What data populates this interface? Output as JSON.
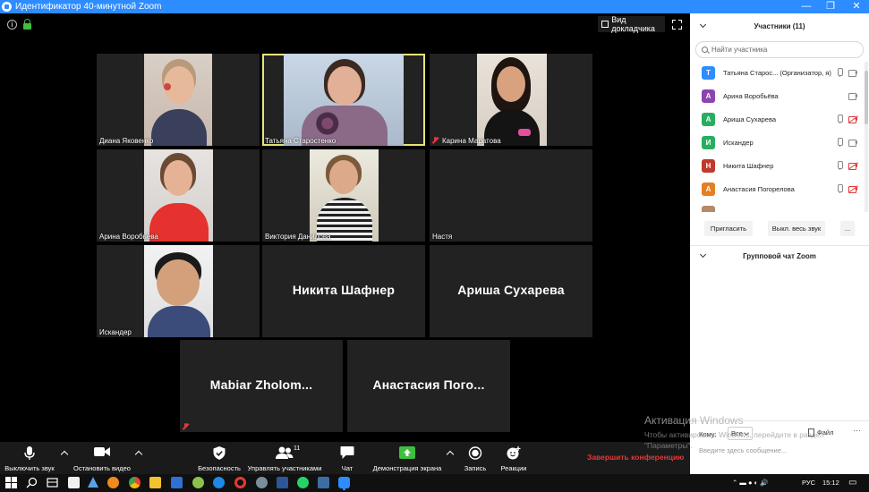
{
  "window": {
    "title": "Идентификатор 40-минутной Zoom"
  },
  "video_header": {
    "speaker_view_label": "Вид докладчика"
  },
  "tiles": [
    {
      "name": "Диана Яковенко",
      "video": true
    },
    {
      "name": "Татьяна Старостенко",
      "video": true,
      "active": true
    },
    {
      "name": "Карина Маратова",
      "video": true,
      "muted": true
    },
    {
      "name": "Арина Воробьёва",
      "video": true
    },
    {
      "name": "Виктория Данилова",
      "video": true
    },
    {
      "name": "Настя",
      "video": false
    },
    {
      "name": "Искандер",
      "video": true
    },
    {
      "display": "Никита Шафнер",
      "video": false
    },
    {
      "display": "Ариша Сухарева",
      "video": false
    },
    {
      "display": "Mabiar  Zholom...",
      "video": false,
      "muted": true
    },
    {
      "display": "Анастасия  Пого...",
      "video": false
    }
  ],
  "toolbar": {
    "mute": "Выключить звук",
    "stop_video": "Остановить видео",
    "security": "Безопасность",
    "participants": "Управлять участниками",
    "participants_count": "11",
    "chat": "Чат",
    "share": "Демонстрация экрана",
    "record": "Запись",
    "reactions": "Реакции",
    "end": "Завершить конференцию"
  },
  "panel": {
    "title": "Участники (11)",
    "search_placeholder": "Найти участника",
    "participants": [
      {
        "initial": "Т",
        "name": "Татьяна Старос... (Организатор, я)",
        "color": "#2d8cff",
        "mic": true,
        "cam_off": false
      },
      {
        "initial": "А",
        "name": "Арина Воробьёва",
        "color": "#8e44ad",
        "mic": false,
        "cam_off": false
      },
      {
        "initial": "А",
        "name": "Ариша Сухарева",
        "color": "#27ae60",
        "mic": true,
        "cam_off": true
      },
      {
        "initial": "И",
        "name": "Искандер",
        "color": "#27ae60",
        "mic": true,
        "cam_off": false
      },
      {
        "initial": "Н",
        "name": "Никита Шафнер",
        "color": "#c0392b",
        "mic": true,
        "cam_off": true
      },
      {
        "initial": "А",
        "name": "Анастасия Погорелова",
        "color": "#e67e22",
        "mic": true,
        "cam_off": true
      }
    ],
    "invite": "Пригласить",
    "mute_all": "Выкл. весь звук",
    "more": "...",
    "chat_title": "Групповой чат Zoom",
    "to_label": "Кому:",
    "to_value": "Все",
    "file_label": "Файл",
    "more_dots": "···",
    "message_placeholder": "Введите здесь сообщение..."
  },
  "watermark": {
    "line1": "Активация Windows",
    "line2": "Чтобы активировать Windows, перейдите в раздел \"Параметры\"."
  },
  "tray": {
    "lang": "РУС",
    "time": "15:12"
  }
}
